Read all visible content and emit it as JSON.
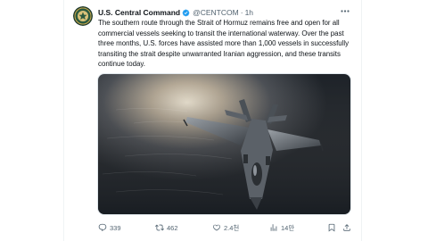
{
  "tweet": {
    "author_name": "U.S. Central Command",
    "handle": "@CENTCOM",
    "separator": "·",
    "time": "1h",
    "text": "The southern route through the Strait of Hormuz remains free and open for all commercial vessels seeking to transit the international waterway. Over the past three months, U.S. forces have assisted more than 1,000 vessels in successfully transiting the strait despite unwarranted Iranian aggression, and these transits continue today.",
    "media_alt": "F-35 fighter jet flying over the sea"
  },
  "actions": {
    "replies": "339",
    "retweets": "462",
    "likes": "2.4천",
    "views": "14만"
  },
  "colors": {
    "text_primary": "#0f1419",
    "text_secondary": "#536471",
    "verified": "#1d9bf0",
    "divider": "#eff3f4"
  },
  "icons": {
    "avatar": "centcom-seal-icon",
    "verified": "verified-badge-icon",
    "more": "more-icon",
    "reply": "reply-icon",
    "retweet": "retweet-icon",
    "like": "like-icon",
    "views": "views-icon",
    "bookmark": "bookmark-icon",
    "share": "share-icon"
  }
}
